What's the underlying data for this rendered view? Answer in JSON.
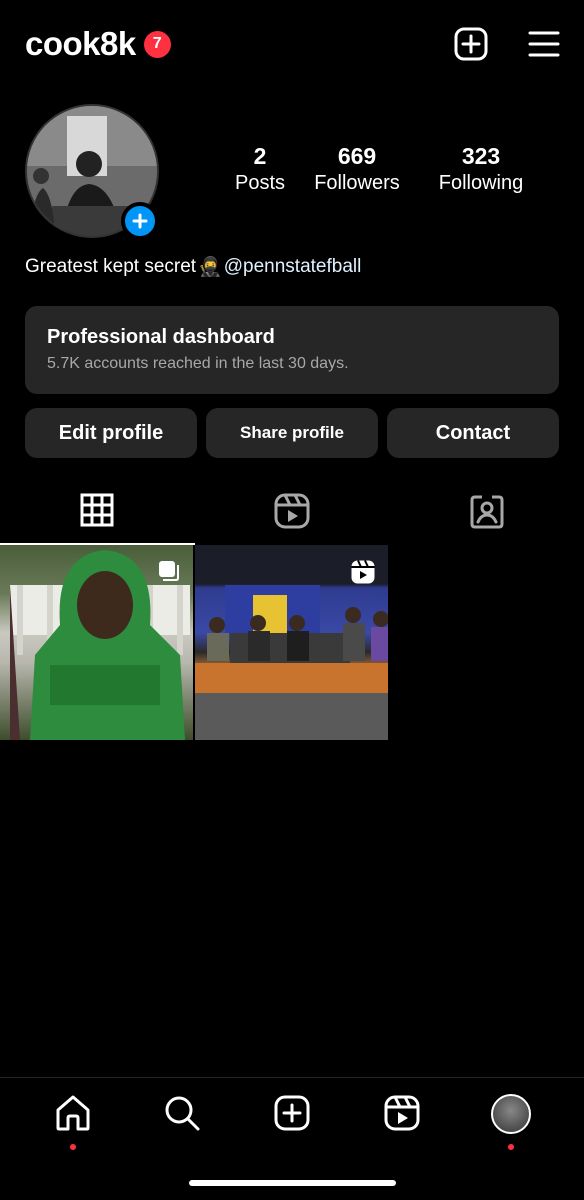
{
  "header": {
    "username": "cook8k",
    "notifications_count": "7",
    "create_icon": "plus-square-icon",
    "menu_icon": "hamburger-menu-icon"
  },
  "profile": {
    "avatar_alt": "profile picture",
    "stats": [
      {
        "value": "2",
        "label": "Posts"
      },
      {
        "value": "669",
        "label": "Followers"
      },
      {
        "value": "323",
        "label": "Following"
      }
    ],
    "bio_text": "Greatest kept secret",
    "bio_emoji": "🥷",
    "bio_mention": "@pennstatefball"
  },
  "dashboard": {
    "title": "Professional dashboard",
    "subtitle": "5.7K accounts reached in the last 30 days."
  },
  "buttons": {
    "edit": "Edit profile",
    "share": "Share profile",
    "contact": "Contact"
  },
  "tabs": [
    {
      "icon": "grid-icon",
      "active": true
    },
    {
      "icon": "reels-icon",
      "active": false
    },
    {
      "icon": "tagged-icon",
      "active": false
    }
  ],
  "posts": [
    {
      "type": "carousel"
    },
    {
      "type": "reel"
    }
  ],
  "bottom_nav": [
    {
      "icon": "home-icon",
      "dot": true
    },
    {
      "icon": "search-icon",
      "dot": false
    },
    {
      "icon": "create-icon",
      "dot": false
    },
    {
      "icon": "reels-icon",
      "dot": false
    },
    {
      "icon": "profile-avatar",
      "dot": true
    }
  ],
  "colors": {
    "background": "#000000",
    "surface": "#262626",
    "accent": "#0095f6",
    "badge": "#ff3040"
  }
}
